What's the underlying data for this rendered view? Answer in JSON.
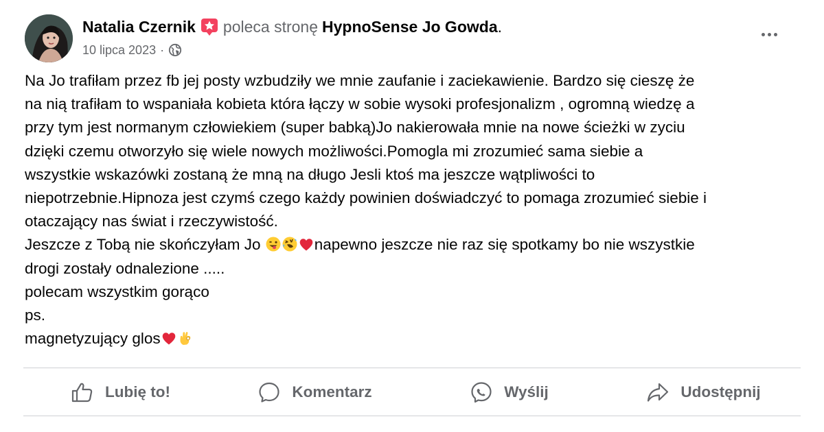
{
  "header": {
    "author": "Natalia Czernik",
    "verb": "poleca stronę",
    "page_name": "HypnoSense Jo Gowda",
    "period": ".",
    "date": "10 lipca 2023",
    "separator": "·",
    "privacy_icon": "globe-icon",
    "recommend_icon": "recommend-badge-icon",
    "more_icon": "more-options-icon"
  },
  "post": {
    "lines": [
      "Na Jo trafiłam przez fb jej posty wzbudziły we mnie zaufanie i zaciekawienie. Bardzo się cieszę że",
      "na nią trafiłam to wspaniała kobieta która łączy w sobie wysoki profesjonalizm , ogromną wiedzę a",
      "przy  tym jest normanym człowiekiem (super babką)Jo nakierowała mnie na nowe ścieżki w zyciu",
      "dzięki czemu otworzyło się wiele nowych możliwości.Pomogla mi zrozumieć sama siebie a",
      "wszystkie wskazówki zostaną że mną na długo Jesli ktoś ma jeszcze wątpliwości to",
      "niepotrzebnie.Hipnoza jest czymś czego każdy powinien doświadczyć to pomaga zrozumieć siebie i",
      "otaczający nas świat i rzeczywistość."
    ],
    "line8_start": "Jeszcze z Tobą nie skończyłam Jo ",
    "line8_end": "napewno jeszcze nie raz się spotkamy bo nie wszystkie",
    "line9": "drogi zostały odnalezione .....",
    "line10": "polecam wszystkim gorąco",
    "line11": "ps.",
    "line12": "magnetyzujący glos",
    "emojis": [
      "winking-tongue-face-emoji",
      "rolling-laughing-face-emoji",
      "red-heart-emoji",
      "red-heart-emoji",
      "ok-hand-emoji"
    ]
  },
  "actions": {
    "like": {
      "label": "Lubię to!",
      "icon": "thumbs-up-icon"
    },
    "comment": {
      "label": "Komentarz",
      "icon": "comment-icon"
    },
    "send": {
      "label": "Wyślij",
      "icon": "messenger-icon"
    },
    "share": {
      "label": "Udostępnij",
      "icon": "share-icon"
    }
  },
  "colors": {
    "text_primary": "#050505",
    "text_secondary": "#65676b",
    "divider": "#ced0d4",
    "recommend_badge": "#f3425f"
  }
}
